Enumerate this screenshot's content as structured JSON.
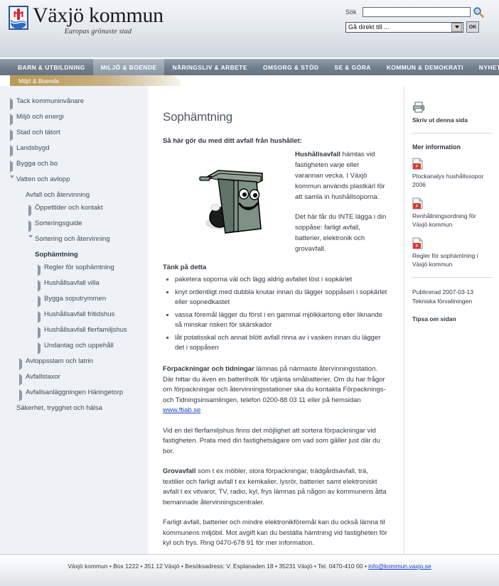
{
  "header": {
    "logo_name": "Växjö kommun",
    "logo_tagline": "Europas grönaste stad",
    "search_label": "Sök",
    "search_value": "",
    "search_placeholder": "",
    "goto_value": "Gå direkt till ...",
    "ok_label": "OK"
  },
  "nav": {
    "items": [
      {
        "label": "BARN & UTBILDNING",
        "active": false
      },
      {
        "label": "MILJÖ & BOENDE",
        "active": true
      },
      {
        "label": "NÄRINGSLIV & ARBETE",
        "active": false
      },
      {
        "label": "OMSORG & STÖD",
        "active": false
      },
      {
        "label": "SE & GÖRA",
        "active": false
      },
      {
        "label": "KOMMUN & DEMOKRATI",
        "active": false
      },
      {
        "label": "NYHETER",
        "active": false
      }
    ]
  },
  "breadcrumb": {
    "label": "Miljö & Boende"
  },
  "sidebar": {
    "items": [
      {
        "label": "Tack kommuninvånare",
        "indent": 0,
        "arrow": "right",
        "bold": false
      },
      {
        "label": "Miljö och energi",
        "indent": 0,
        "arrow": "right",
        "bold": false
      },
      {
        "label": "Stad och tätort",
        "indent": 0,
        "arrow": "right",
        "bold": false
      },
      {
        "label": "Landsbygd",
        "indent": 0,
        "arrow": "right",
        "bold": false
      },
      {
        "label": "Bygga och bo",
        "indent": 0,
        "arrow": "right",
        "bold": false
      },
      {
        "label": "Vatten och avlopp",
        "indent": 0,
        "arrow": "down",
        "bold": false
      },
      {
        "label": "Avfall och återvinning",
        "indent": 1,
        "arrow": "none",
        "bold": false
      },
      {
        "label": "Öppettider och kontakt",
        "indent": 2,
        "arrow": "right",
        "bold": false
      },
      {
        "label": "Sorteringsguide",
        "indent": 2,
        "arrow": "right",
        "bold": false
      },
      {
        "label": "Sortering och återvinning",
        "indent": 2,
        "arrow": "down",
        "bold": false
      },
      {
        "label": "Sophämtning",
        "indent": 2,
        "arrow": "none",
        "bold": true
      },
      {
        "label": "Regler för sophämtning",
        "indent": 3,
        "arrow": "right",
        "bold": false
      },
      {
        "label": "Hushållsavfall villa",
        "indent": 3,
        "arrow": "right",
        "bold": false
      },
      {
        "label": "Bygga soputrymmen",
        "indent": 3,
        "arrow": "right",
        "bold": false
      },
      {
        "label": "Hushållsavfall fritidshus",
        "indent": 3,
        "arrow": "right",
        "bold": false
      },
      {
        "label": "Hushållsavfall flerfamiljshus",
        "indent": 3,
        "arrow": "right",
        "bold": false
      },
      {
        "label": "Undantag och uppehåll",
        "indent": 3,
        "arrow": "right",
        "bold": false
      },
      {
        "label": "Avloppsslam och latrin",
        "indent": 1,
        "arrow": "right",
        "bold": false
      },
      {
        "label": "Avfallstaxor",
        "indent": 1,
        "arrow": "right",
        "bold": false
      },
      {
        "label": "Avfallsanläggningen Häringetorp",
        "indent": 1,
        "arrow": "right",
        "bold": false
      },
      {
        "label": "Säkerhet, trygghet och hälsa",
        "indent": 0,
        "arrow": "none",
        "bold": false
      }
    ]
  },
  "main": {
    "title": "Sophämtning",
    "lead": "Så här gör du med ditt avfall från hushållet:",
    "intro_bold": "Hushållsavfall",
    "intro_rest": " hämtas vid fastigheten varje eller varannan vecka. I Växjö kommun används plastkärl för att samla in hushållsoporna.",
    "intro_second": "Det här får du INTE lägga i din soppåse: farligt avfall, batterier, elektronik och grovavfall.",
    "tips_heading": "Tänk på detta",
    "tips": [
      "paketera soporna väl och lägg aldrig avfallet löst i sopkärlet",
      "knyt ordentligt med dubbla knutar innan du lägger soppåsen i sopkärlet eller sopnedkastet",
      "vassa föremål lägger du först i en gammal mjölkkartong eller liknande så minskar risken för skärskador",
      "låt potatisskal och annat blött avfall rinna av i vasken innan du lägger det i soppåsen"
    ],
    "para_packaging_bold": "Förpackningar och tidningar",
    "para_packaging_rest": " lämnas på närmaste återvinningsstation. Där hittar du även en batteriholk för utjänta småbatterier.  Om du har frågor om förpackningar och återvinningsstationer ska du kontakta Förpacknings- och Tidningsinsamlingen, telefon 0200-88 03 11 eller på hemsidan ",
    "para_packaging_link": "www.ftiab.se",
    "para_flerfamilj": "Vid en del flerfamiljshus finns det möjlighet att sortera förpackningar vid fastigheten. Prata med din fastighetsägare om vad som gäller just där du bor.",
    "para_grovavfall_bold": "Grovavfall",
    "para_grovavfall_rest": " som t ex möbler, stora förpackningar, trädgårdsavfall, trä, textilier och farligt avfall t ex kemkalier, lysrör,  batterier samt elektroniskt avfall t ex vitvaror, TV, radio, kyl, frys lämnas på någon av kommunens åtta bemannade återvinningscentraler.",
    "para_farligt": "Farligt avfall, batterier och mindre elektronikföremål kan du också lämna til kommunens miljöbil. Mot avgift kan du beställa hämtning vid fastigheten för kyl och frys. Ring 0470-678 91 för mer information."
  },
  "rightcol": {
    "print_label": "Skriv ut denna sida",
    "more_info_heading": "Mer information",
    "pdfs": [
      {
        "label": "Plockanalys hushållssopor 2006"
      },
      {
        "label": "Renhållningsordning för Växjö kommun"
      },
      {
        "label": "Regler för sophämtning i Växjö kommun"
      }
    ],
    "published_date": "Publicerad 2007-03-13",
    "published_dept": "Tekniska förvaltningen",
    "tip_label": "Tipsa om sidan"
  },
  "footer": {
    "text": "Växjö kommun • Box 1222 • 351 12 Växjö • Besöksadress: V. Esplanaden 18 • 35231 Växjö • Tel. 0470-410 00 • ",
    "email": "info@kommun.vaxjo.se"
  },
  "colors": {
    "nav_bg": "#73818f",
    "nav_active": "#97a3b1",
    "crumb_gold": "#b79a55",
    "sidebar_bg": "#eef1f6",
    "link_blue": "#1b3fd4",
    "text": "#2f3844"
  }
}
